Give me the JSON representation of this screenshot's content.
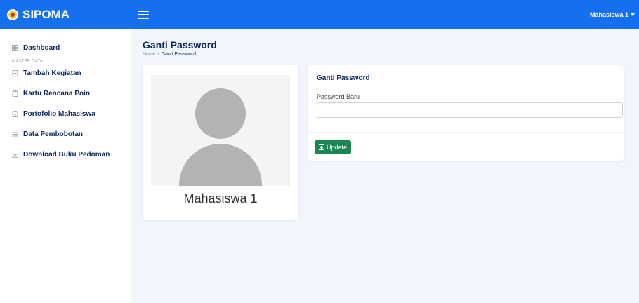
{
  "app": {
    "brand": "SIPOMA"
  },
  "topbar": {
    "user_name": "Mahasiswa 1"
  },
  "sidebar": {
    "dashboard": {
      "label": "Dashboard",
      "icon": "grid-icon"
    },
    "section_label": "MASTER DATA",
    "items": [
      {
        "label": "Tambah Kegiatan",
        "icon": "plus-square-icon"
      },
      {
        "label": "Kartu Rencana Poin",
        "icon": "clipboard-icon"
      },
      {
        "label": "Portofolio Mahasiswa",
        "icon": "clipboard-list-icon"
      },
      {
        "label": "Data Pembobotan",
        "icon": "list-icon"
      },
      {
        "label": "Download Buku Pedoman",
        "icon": "download-icon"
      }
    ]
  },
  "page": {
    "title": "Ganti Password",
    "breadcrumb": {
      "home": "Home",
      "current": "Ganti Password"
    }
  },
  "profile": {
    "name": "Mahasiswa 1"
  },
  "password_form": {
    "title": "Ganti Password",
    "field_label": "Password Baru",
    "field_value": "",
    "button_label": "Update"
  },
  "colors": {
    "primary": "#1570f0",
    "success": "#198754",
    "navy": "#0d2a5c",
    "background": "#f1f5fc"
  }
}
